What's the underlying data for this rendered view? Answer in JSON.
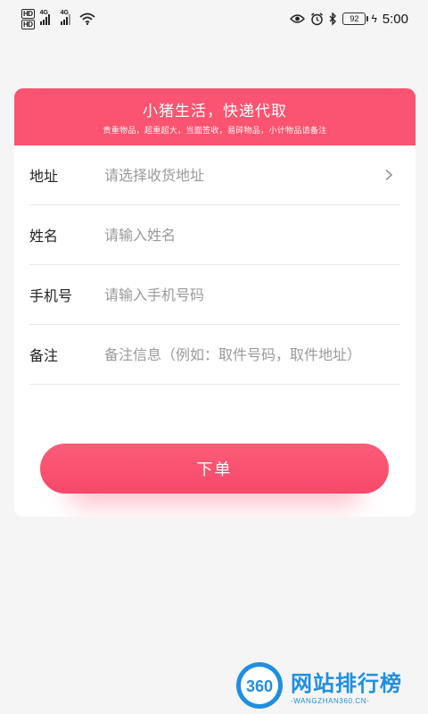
{
  "status_bar": {
    "hd_labels": [
      "HD",
      "HD"
    ],
    "network": [
      "4G",
      "4G"
    ],
    "battery": "92",
    "time": "5:00",
    "icons": [
      "eye-icon",
      "alarm-icon",
      "bluetooth-icon",
      "charging-icon",
      "wifi-icon"
    ]
  },
  "card": {
    "title": "小猪生活，快递代取",
    "subtitle": "贵重物品，超重超大，当面签收，易碎物品，小计物品请备注",
    "accent_color": "#fb5470"
  },
  "form": {
    "address": {
      "label": "地址",
      "placeholder": "请选择收货地址"
    },
    "name": {
      "label": "姓名",
      "placeholder": "请输入姓名"
    },
    "phone": {
      "label": "手机号",
      "placeholder": "请输入手机号码"
    },
    "note": {
      "label": "备注",
      "placeholder": "备注信息（例如：取件号码，取件地址）"
    }
  },
  "submit": {
    "label": "下单"
  },
  "watermark": {
    "badge": "360",
    "text": "网站排行榜",
    "sub": "-WANGZHAN360.CN-"
  }
}
